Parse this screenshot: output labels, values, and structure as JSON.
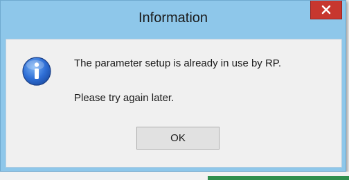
{
  "window": {
    "title": "Information",
    "close_icon": "close-icon"
  },
  "message": {
    "line1": "The parameter setup is already in use by RP.",
    "line2": "Please try again later.",
    "icon": "info-icon"
  },
  "buttons": {
    "ok_label": "OK"
  },
  "colors": {
    "titlebar": "#8ec7ea",
    "close_button": "#c7372f",
    "client_bg": "#f0f0f0",
    "button_bg": "#e1e1e1"
  }
}
